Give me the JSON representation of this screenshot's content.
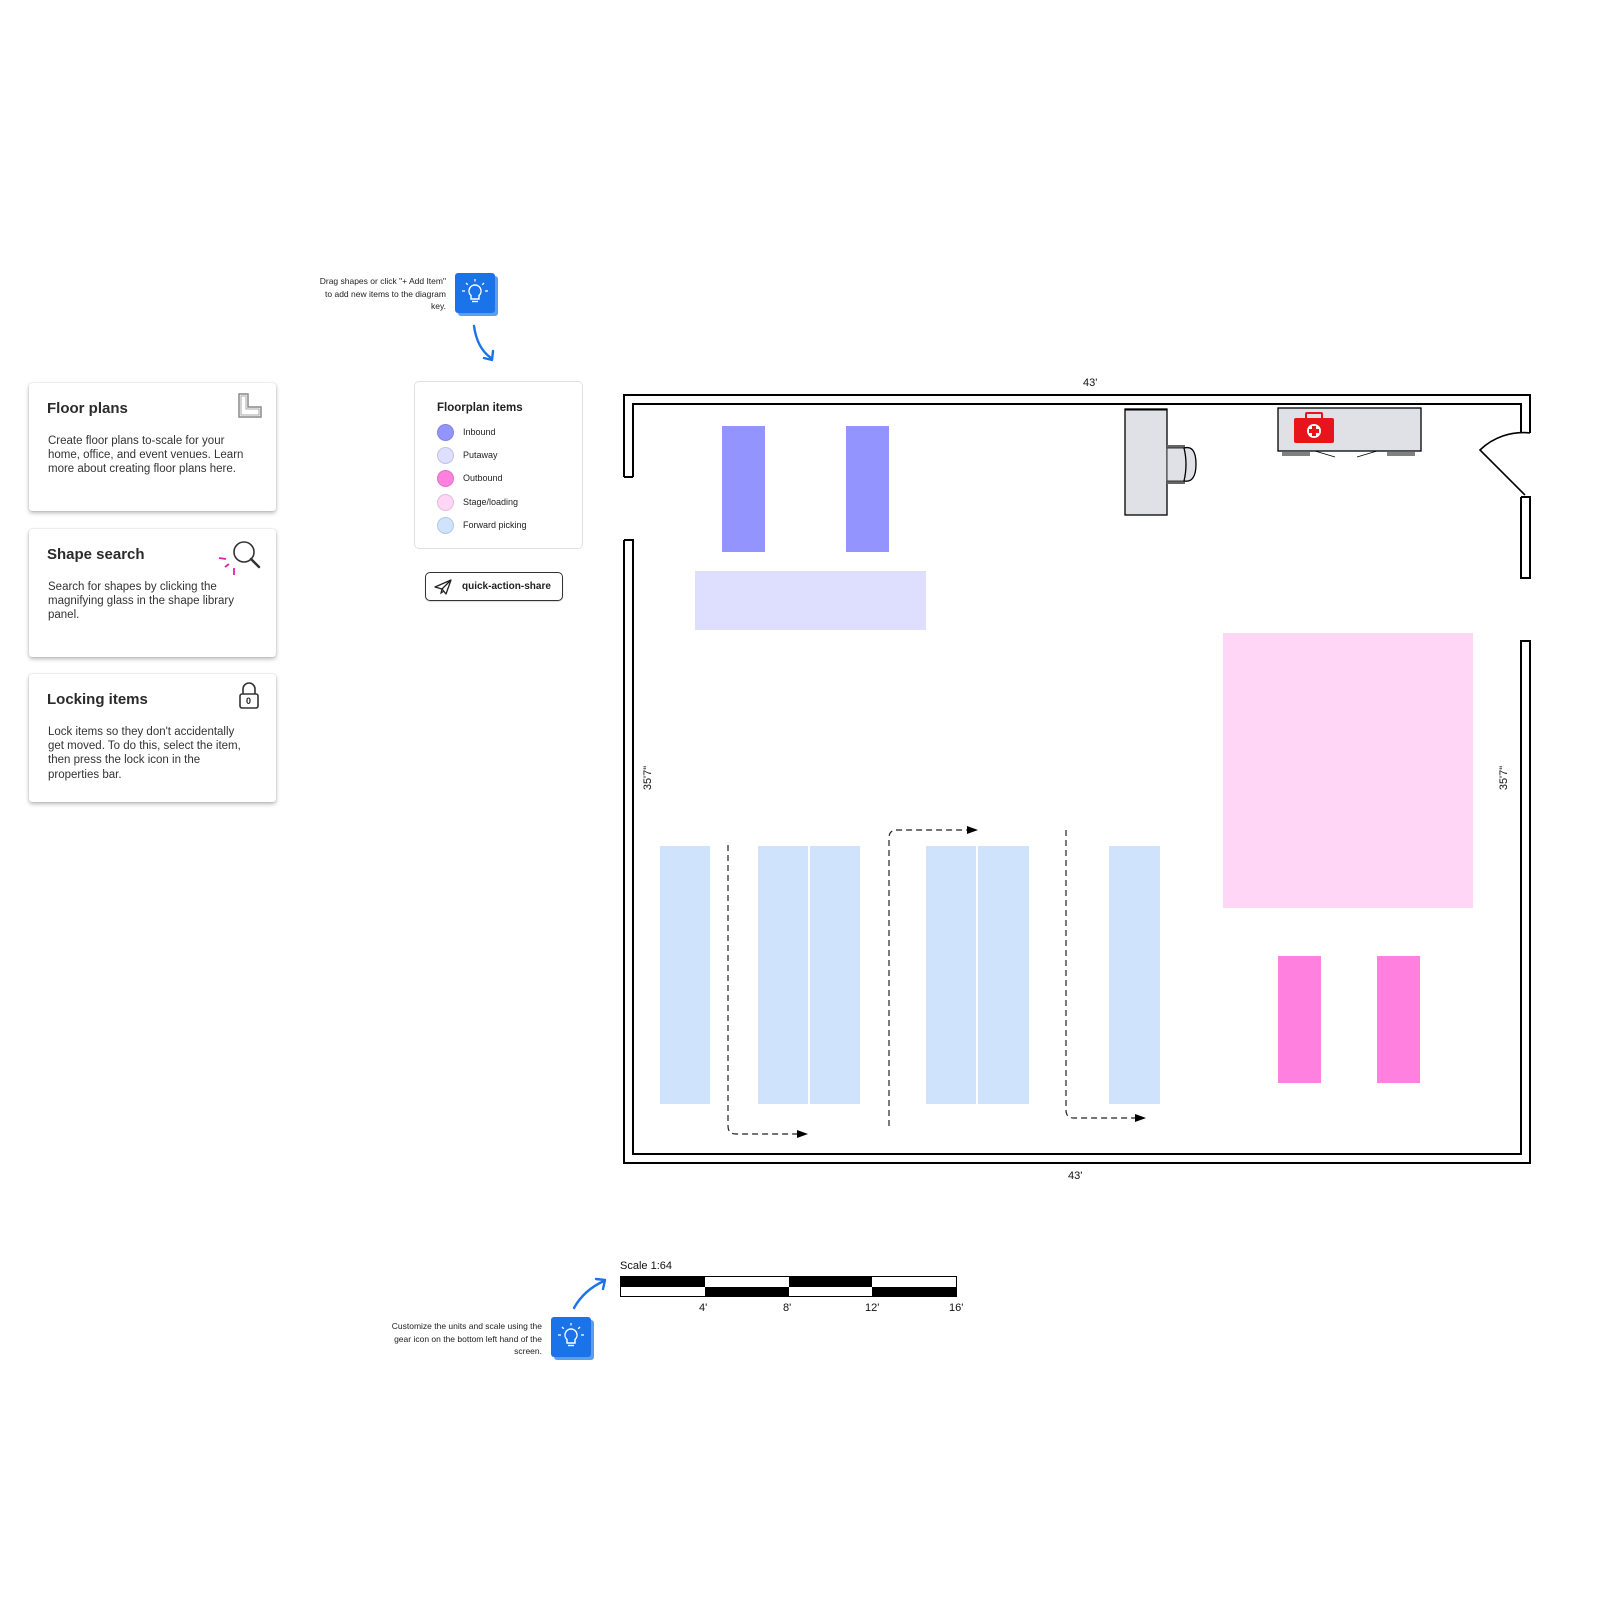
{
  "cards": [
    {
      "title": "Floor plans",
      "body": "Create floor plans to-scale for your home, office, and event venues. Learn more about creating floor plans here.",
      "icon": "floor-plan-icon"
    },
    {
      "title": "Shape search",
      "body": "Search for shapes by clicking the magnifying glass in the shape library panel.",
      "icon": "magnifying-glass-icon"
    },
    {
      "title": "Locking items",
      "body": "Lock items so they don't accidentally get moved. To do this, select the item, then press the lock icon in the properties bar.",
      "icon": "lock-icon",
      "lock_glyph": "0"
    }
  ],
  "hints": {
    "legend_hint": "Drag shapes or click \"+ Add Item\" to add new items to the diagram key.",
    "scale_hint": "Customize the units and scale using the gear icon on the bottom left hand of the screen.",
    "icon": "lightbulb-icon"
  },
  "legend": {
    "title": "Floorplan items",
    "items": [
      {
        "label": "Inbound",
        "color": "#9494ff"
      },
      {
        "label": "Putaway",
        "color": "#dedeff"
      },
      {
        "label": "Outbound",
        "color": "#ff80df"
      },
      {
        "label": "Stage/loading",
        "color": "#ffd6f5"
      },
      {
        "label": "Forward picking",
        "color": "#cfe3fc"
      }
    ]
  },
  "share_button": {
    "label": "quick-action-share",
    "icon": "paper-plane-icon"
  },
  "floorplan": {
    "dimensions": {
      "top": "43'",
      "bottom": "43'",
      "left": "35'7\"",
      "right": "35'7\""
    },
    "colors": {
      "inbound": "#9494ff",
      "putaway": "#dedeff",
      "outbound": "#ff80df",
      "stage": "#ffd6f5",
      "forward": "#cfe3fc",
      "furniture": "#dfe1e6",
      "first_aid": "#e8141b"
    },
    "furniture": [
      "desk",
      "office-chair",
      "counter",
      "first-aid-kit",
      "door"
    ]
  },
  "scale": {
    "title": "Scale 1:64",
    "ticks": [
      "4'",
      "8'",
      "12'",
      "16'"
    ]
  }
}
